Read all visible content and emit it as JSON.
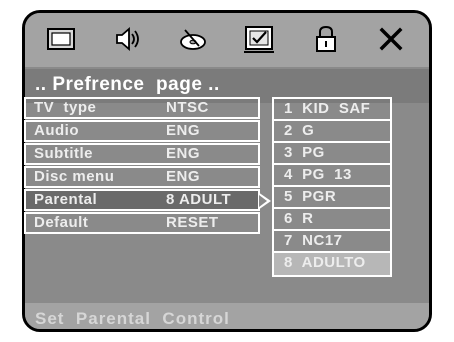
{
  "toolbar": {
    "tabs": [
      {
        "icon": "tv-screen-icon"
      },
      {
        "icon": "speaker-icon"
      },
      {
        "icon": "disc-icon"
      },
      {
        "icon": "checked-screen-icon"
      },
      {
        "icon": "padlock-icon"
      },
      {
        "icon": "close-icon"
      }
    ]
  },
  "header": {
    "title": ".. Prefrence  page .."
  },
  "menu": {
    "rows": [
      {
        "label": "TV  type",
        "value": "NTSC"
      },
      {
        "label": "Audio",
        "value": "ENG"
      },
      {
        "label": "Subtitle",
        "value": "ENG"
      },
      {
        "label": "Disc menu",
        "value": "ENG"
      },
      {
        "label": "Parental",
        "value": "8 ADULT",
        "selected": true
      },
      {
        "label": "Default",
        "value": "RESET"
      }
    ]
  },
  "options": [
    {
      "label": "1  KID  SAF"
    },
    {
      "label": "2  G"
    },
    {
      "label": "3  PG"
    },
    {
      "label": "4  PG  13"
    },
    {
      "label": "5  PGR"
    },
    {
      "label": "6  R"
    },
    {
      "label": "7  NC17"
    },
    {
      "label": "8  ADULTO",
      "highlighted": true
    }
  ],
  "status": {
    "text": "Set  Parental  Control"
  },
  "colors": {
    "panel": "#8a8a8a",
    "toolbar": "#a3a3a3",
    "selected_row": "#6a6a6a",
    "highlighted_option": "#b7b7b7"
  }
}
